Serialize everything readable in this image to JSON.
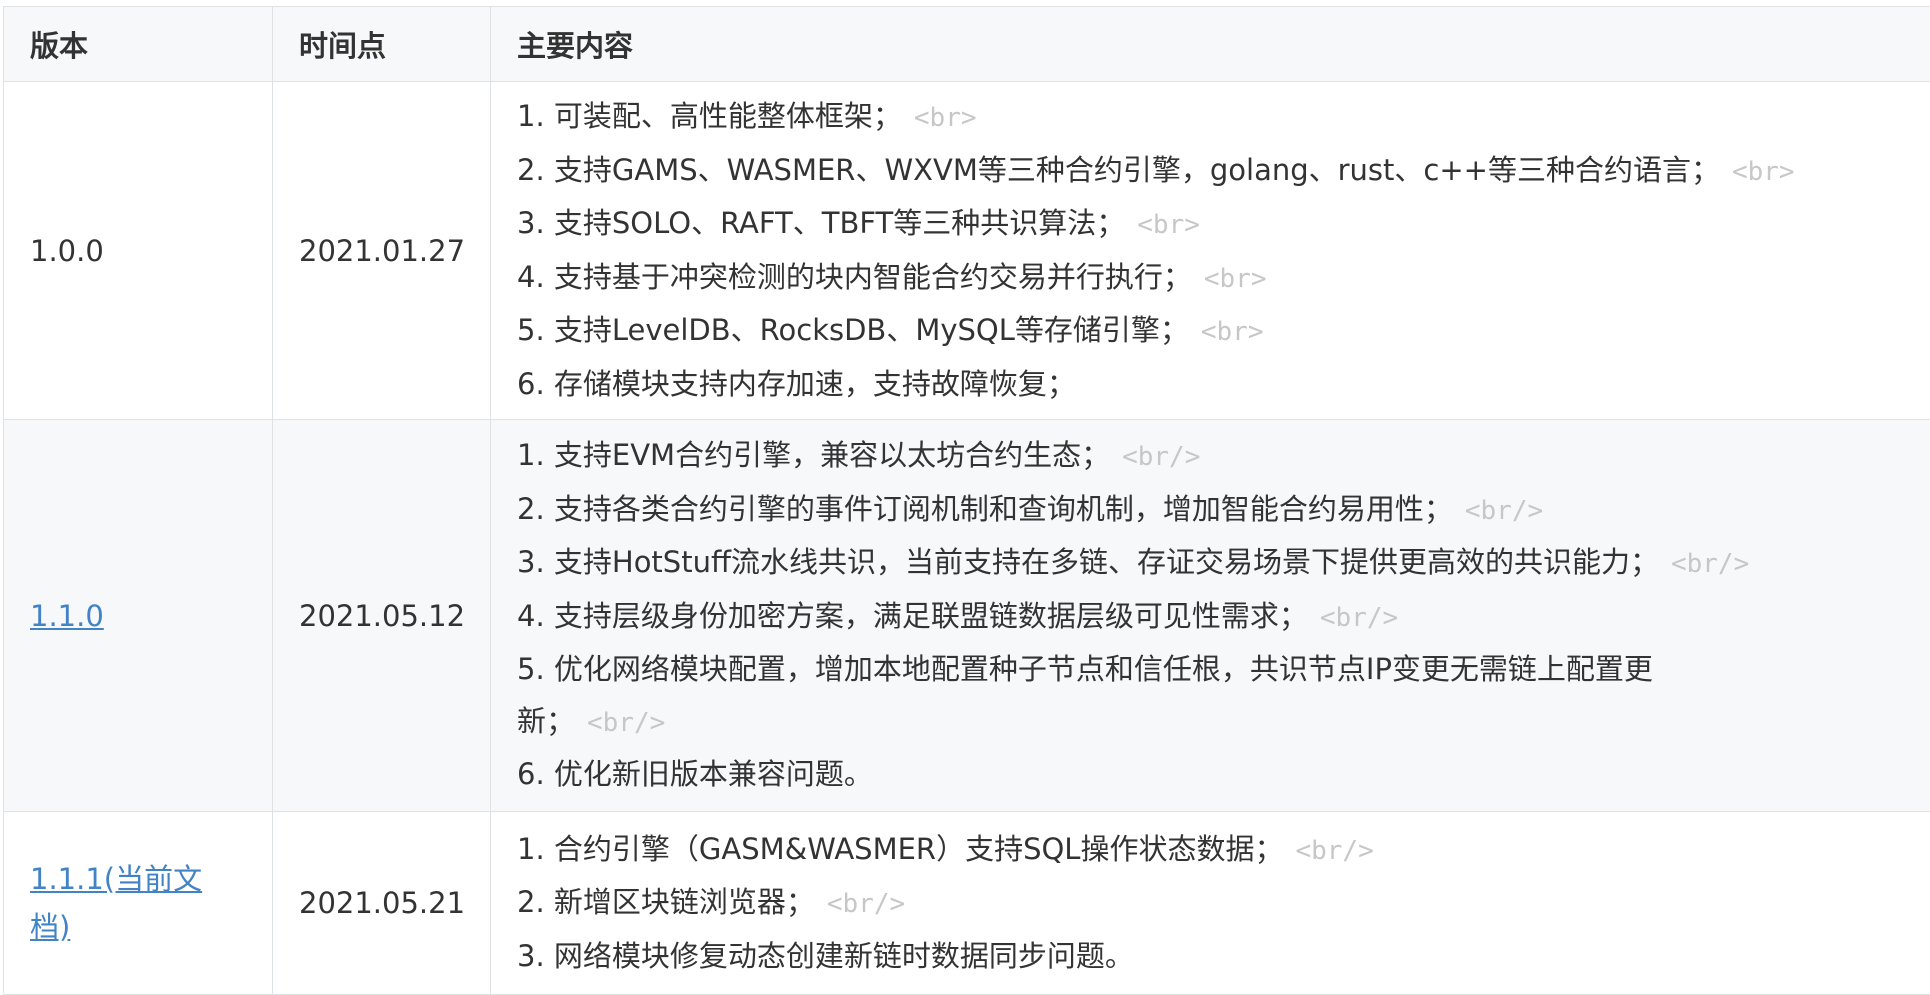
{
  "table": {
    "headers": [
      "版本",
      "时间点",
      "主要内容"
    ],
    "rows": [
      {
        "version": "1.0.0",
        "date": "2021.01.27",
        "lines": [
          {
            "text": "1. 可装配、高性能整体框架；",
            "tag": "<br>"
          },
          {
            "text": "2. 支持GAMS、WASMER、WXVM等三种合约引擎，golang、rust、c++等三种合约语言；",
            "tag": "<br>"
          },
          {
            "text": "3. 支持SOLO、RAFT、TBFT等三种共识算法；",
            "tag": "<br>"
          },
          {
            "text": "4. 支持基于冲突检测的块内智能合约交易并行执行；",
            "tag": "<br>"
          },
          {
            "text": "5. 支持LevelDB、RocksDB、MySQL等存储引擎；",
            "tag": "<br>"
          },
          {
            "text": "6. 存储模块支持内存加速，支持故障恢复；",
            "tag": ""
          }
        ]
      },
      {
        "version": "1.1.0",
        "date": "2021.05.12",
        "lines": [
          {
            "text": "1. 支持EVM合约引擎，兼容以太坊合约生态；",
            "tag": "<br/>"
          },
          {
            "text": "2. 支持各类合约引擎的事件订阅机制和查询机制，增加智能合约易用性；",
            "tag": "<br/>"
          },
          {
            "text": "3. 支持HotStuff流水线共识，当前支持在多链、存证交易场景下提供更高效的共识能力；",
            "tag": "<br/>"
          },
          {
            "text": "4. 支持层级身份加密方案，满足联盟链数据层级可见性需求；",
            "tag": "<br/>"
          },
          {
            "text": "5. 优化网络模块配置，增加本地配置种子节点和信任根，共识节点IP变更无需链上配置更",
            "tag": ""
          },
          {
            "text": "新；",
            "tag": "<br/>"
          },
          {
            "text": "6. 优化新旧版本兼容问题。",
            "tag": ""
          }
        ]
      },
      {
        "version_line1": "1.1.1(当前文",
        "version_line2": "档)",
        "date": "2021.05.21",
        "lines": [
          {
            "text": "1. 合约引擎（GASM&WASMER）支持SQL操作状态数据；",
            "tag": "<br/>"
          },
          {
            "text": "2. 新增区块链浏览器；",
            "tag": "<br/>"
          },
          {
            "text": "3. 网络模块修复动态创建新链时数据同步问题。",
            "tag": ""
          }
        ]
      }
    ]
  }
}
